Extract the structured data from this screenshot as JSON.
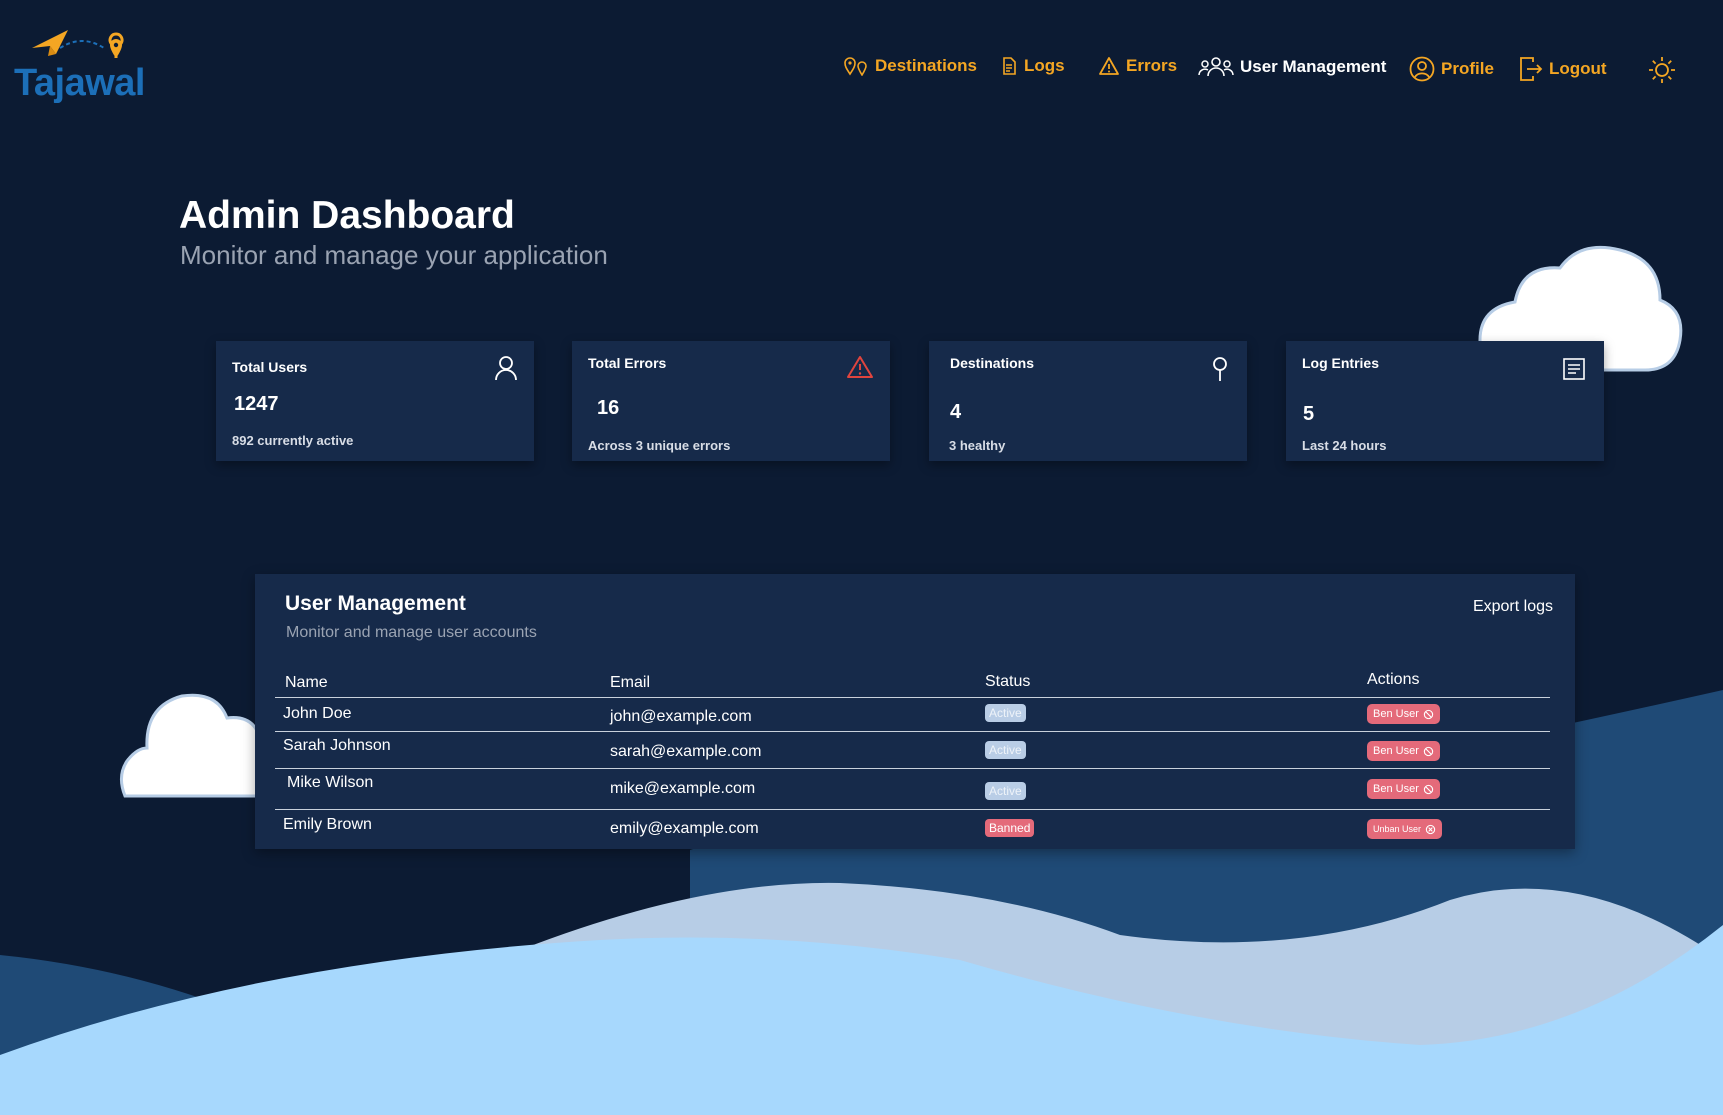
{
  "brand": {
    "name": "Tajawal",
    "accent": "#f4a623",
    "logo_color": "#1c6fb8"
  },
  "nav": {
    "items": [
      {
        "label": "Destinations",
        "icon": "map-pins-icon"
      },
      {
        "label": "Logs",
        "icon": "document-icon"
      },
      {
        "label": "Errors",
        "icon": "warning-icon"
      },
      {
        "label": "User Management",
        "icon": "users-icon",
        "active": true
      },
      {
        "label": "Profile",
        "icon": "user-circle-icon"
      },
      {
        "label": "Logout",
        "icon": "logout-icon"
      }
    ],
    "theme_toggle_icon": "sun-icon"
  },
  "header": {
    "title": "Admin Dashboard",
    "subtitle": "Monitor and manage your application"
  },
  "stats": [
    {
      "title": "Total Users",
      "value": "1247",
      "sub": "892 currently active",
      "icon": "user-icon"
    },
    {
      "title": "Total Errors",
      "value": "16",
      "sub": "Across 3 unique errors",
      "icon": "warning-icon"
    },
    {
      "title": "Destinations",
      "value": "4",
      "sub": "3 healthy",
      "icon": "location-pin-icon"
    },
    {
      "title": "Log Entries",
      "value": "5",
      "sub": "Last 24 hours",
      "icon": "log-document-icon"
    }
  ],
  "user_management": {
    "title": "User Management",
    "subtitle": "Monitor and manage user accounts",
    "export_label": "Export logs",
    "columns": [
      "Name",
      "Email",
      "Status",
      "Actions"
    ],
    "rows": [
      {
        "name": "John Doe",
        "email": "john@example.com",
        "status": "Active",
        "action": "Ben User"
      },
      {
        "name": "Sarah Johnson",
        "email": "sarah@example.com",
        "status": "Active",
        "action": "Ben User"
      },
      {
        "name": "Mike Wilson",
        "email": "mike@example.com",
        "status": "Active",
        "action": "Ben User"
      },
      {
        "name": "Emily Brown",
        "email": "emily@example.com",
        "status": "Banned",
        "action": "Unban User"
      }
    ]
  },
  "colors": {
    "background": "#0c1b33",
    "card": "#162a4a",
    "active_badge": "#b9cde6",
    "banned_badge": "#e46a7a",
    "error_icon": "#e0443e"
  }
}
